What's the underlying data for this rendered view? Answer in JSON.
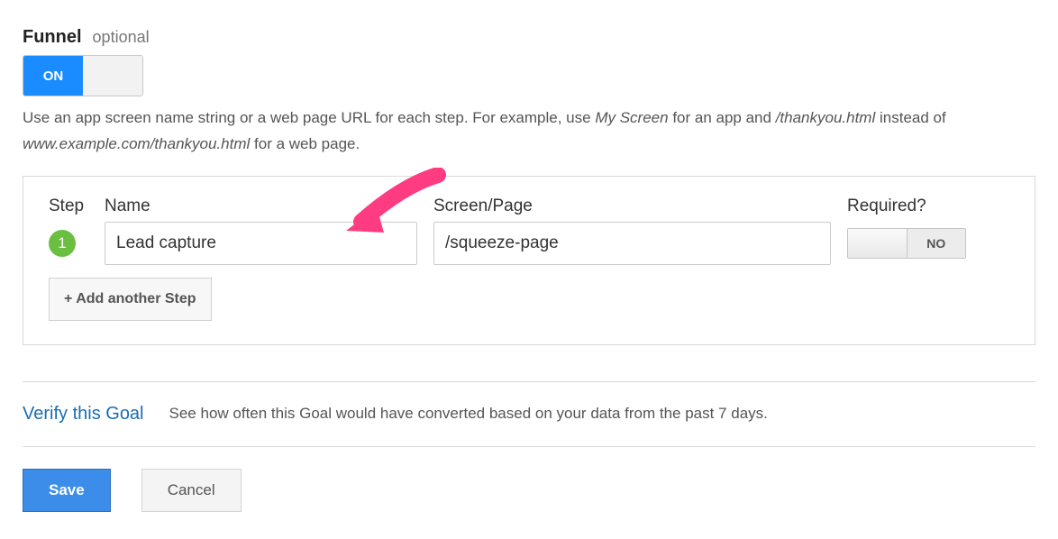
{
  "funnel": {
    "title": "Funnel",
    "optional_label": "optional",
    "toggle": {
      "on_label": "ON",
      "state": "ON"
    },
    "help_text": {
      "prefix": "Use an app screen name string or a web page URL for each step. For example, use ",
      "example_app": "My Screen",
      "mid1": " for an app and ",
      "example_page": "/thankyou.html",
      "mid2": " instead of ",
      "example_bad": "www.example.com/thankyou.html",
      "suffix": " for a web page."
    },
    "headers": {
      "step": "Step",
      "name": "Name",
      "page": "Screen/Page",
      "required": "Required?"
    },
    "steps": [
      {
        "number": "1",
        "name": "Lead capture",
        "page": "/squeeze-page",
        "required_state": "NO",
        "required_no_label": "NO"
      }
    ],
    "add_step_label": "+ Add another Step"
  },
  "verify": {
    "link_text": "Verify this Goal",
    "description": "See how often this Goal would have converted based on your data from the past 7 days."
  },
  "actions": {
    "save_label": "Save",
    "cancel_label": "Cancel"
  }
}
